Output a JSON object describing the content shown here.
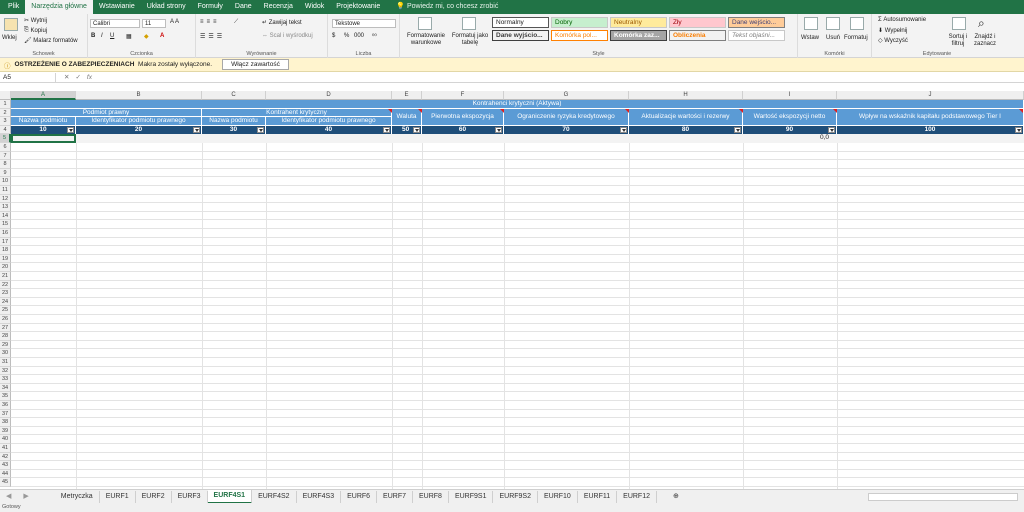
{
  "tabs": [
    "Plik",
    "Narzędzia główne",
    "Wstawianie",
    "Układ strony",
    "Formuły",
    "Dane",
    "Recenzja",
    "Widok",
    "Projektowanie"
  ],
  "active_tab": 1,
  "tell_me": "Powiedz mi, co chcesz zrobić",
  "ribbon": {
    "clipboard": {
      "paste": "Wklej",
      "cut": "Wytnij",
      "copy": "Kopiuj",
      "painter": "Malarz formatów",
      "label": "Schowek"
    },
    "font": {
      "name": "Calibri",
      "size": "11",
      "label": "Czcionka",
      "bold": "B",
      "italic": "I",
      "underline": "U"
    },
    "alignment": {
      "wrap": "Zawijaj tekst",
      "merge": "Scal i wyśrodkuj",
      "label": "Wyrównanie"
    },
    "number": {
      "format": "Tekstowe",
      "label": "Liczba",
      "percent": "%",
      "thousands": "000"
    },
    "styles": {
      "cond": "Formatowanie warunkowe",
      "table": "Formatuj jako tabelę",
      "label": "Style",
      "cells": [
        "Normalny",
        "Dobry",
        "Neutralny",
        "Zły",
        "Dane wejścio...",
        "Dane wyjścio...",
        "Komórka pol...",
        "Komórka zaz...",
        "Obliczenia",
        "Tekst objaśni..."
      ]
    },
    "cells": {
      "insert": "Wstaw",
      "delete": "Usuń",
      "format": "Formatuj",
      "label": "Komórki"
    },
    "editing": {
      "autosum": "Autosumowanie",
      "fill": "Wypełnij",
      "clear": "Wyczyść",
      "sort": "Sortuj i filtruj",
      "find": "Znajdź i zaznacz",
      "label": "Edytowanie"
    }
  },
  "warning": {
    "title": "OSTRZEŻENIE O ZABEZPIECZENIACH",
    "text": "Makra zostały wyłączone.",
    "button": "Włącz zawartość"
  },
  "namebox": "A5",
  "fx": "fx",
  "columns": [
    "A",
    "B",
    "C",
    "D",
    "E",
    "F",
    "G",
    "H",
    "I",
    "J"
  ],
  "rows": [
    "1",
    "2",
    "3",
    "4",
    "5",
    "6",
    "7",
    "8",
    "9",
    "10",
    "11",
    "12",
    "13",
    "14",
    "15",
    "16",
    "17",
    "18",
    "19",
    "20",
    "21",
    "22",
    "23",
    "24",
    "25",
    "26",
    "27",
    "28",
    "29",
    "30",
    "31",
    "32",
    "33",
    "34",
    "35",
    "36",
    "37",
    "38",
    "39",
    "40",
    "41",
    "42",
    "43",
    "44",
    "45"
  ],
  "header": {
    "main": "Kontrahenci krytyczni (Aktywa)",
    "entity": "Podmiot prawny",
    "counterparty": "Kontrahent krytyczny",
    "a": "Nazwa podmiotu",
    "b": "Identyfikator podmiotu prawnego",
    "c": "Nazwa podmiotu",
    "d": "Identyfikator podmiotu prawnego",
    "e": "Waluta",
    "f": "Pierwotna ekspozycja",
    "g": "Ograniczenie ryzyka kredytowego",
    "h": "Aktualizacje wartości i rezerwy",
    "i": "Wartość ekspozycji netto",
    "j": "Wpływ na wskaźnik kapitału podstawowego Tier I"
  },
  "codes": [
    "10",
    "20",
    "30",
    "40",
    "50",
    "60",
    "70",
    "80",
    "90",
    "100"
  ],
  "row5_i": "0,0",
  "sheets": [
    "Metryczka",
    "EURF1",
    "EURF2",
    "EURF3",
    "EURF4S1",
    "EURF4S2",
    "EURF4S3",
    "EURF6",
    "EURF7",
    "EURF8",
    "EURF9S1",
    "EURF9S2",
    "EURF10",
    "EURF11",
    "EURF12"
  ],
  "active_sheet": 4,
  "status": "Gotowy"
}
